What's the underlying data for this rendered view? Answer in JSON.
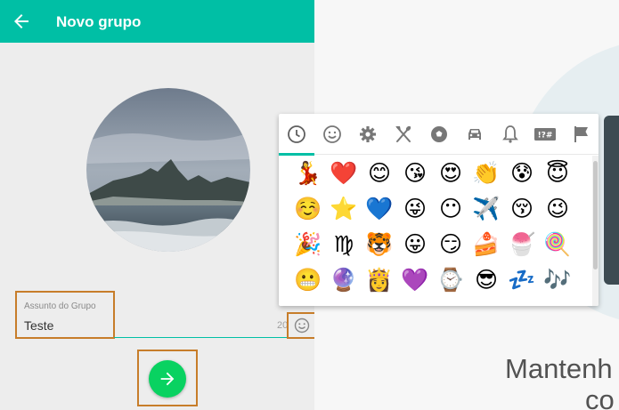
{
  "header": {
    "title": "Novo grupo"
  },
  "subject": {
    "label": "Assunto do Grupo",
    "value": "Teste",
    "remaining": "20"
  },
  "welcome": {
    "line1": "Mantenh",
    "line2": "co"
  },
  "emoji_tabs": [
    {
      "icon": "recent-clock-icon",
      "active": true
    },
    {
      "icon": "smiley-icon"
    },
    {
      "icon": "gear-icon"
    },
    {
      "icon": "fork-knife-icon"
    },
    {
      "icon": "soccer-ball-icon"
    },
    {
      "icon": "car-icon"
    },
    {
      "icon": "bell-icon"
    },
    {
      "icon": "symbols-icon",
      "label": "!?#"
    },
    {
      "icon": "flag-icon"
    }
  ],
  "emojis": [
    [
      "💃",
      "❤️",
      "😊",
      "😘",
      "😍",
      "👏",
      "😰",
      "😇"
    ],
    [
      "☺️",
      "⭐",
      "💙",
      "😜",
      "😶",
      "✈️",
      "😚",
      "😉"
    ],
    [
      "🎉",
      "♍",
      "🐯",
      "😛",
      "😏",
      "🍰",
      "🍧",
      "🍭"
    ],
    [
      "😬",
      "🔮",
      "👸",
      "💜",
      "⌚",
      "😎",
      "💤",
      "🎶"
    ]
  ],
  "colors": {
    "accent": "#00bfa5",
    "send_button": "#09d261",
    "highlight_box": "#c77d2a"
  }
}
